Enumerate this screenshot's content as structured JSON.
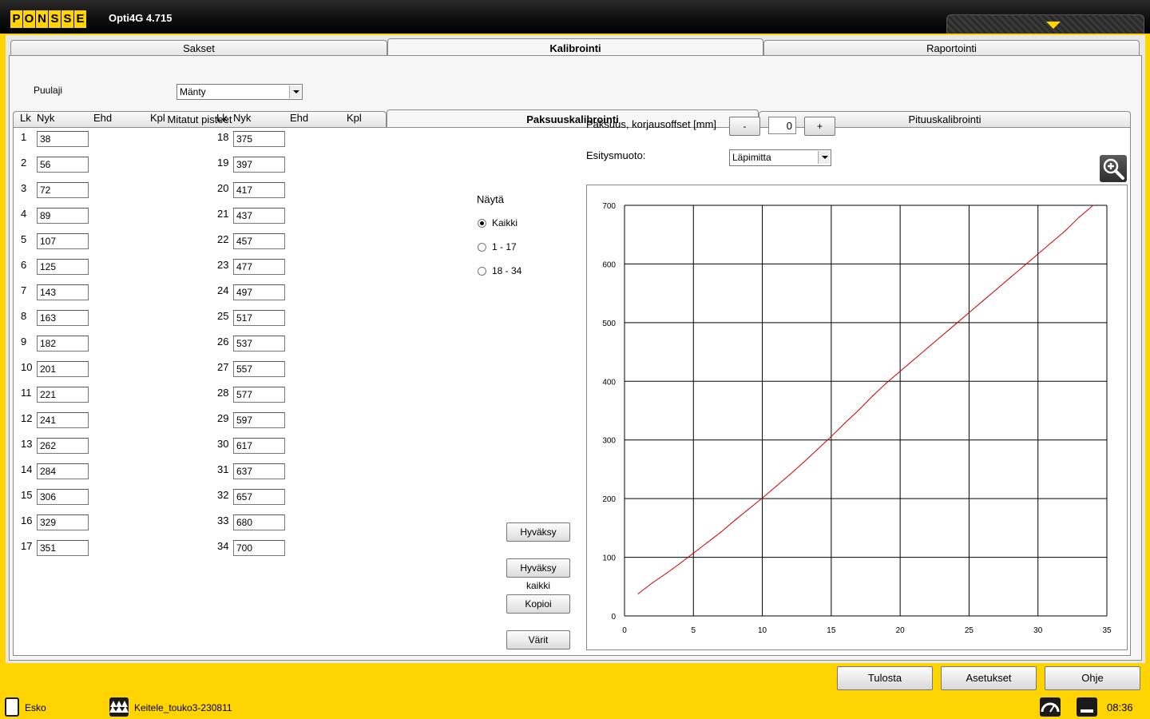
{
  "app": {
    "logo_letters": [
      "P",
      "O",
      "N",
      "S",
      "S",
      "E"
    ],
    "title": "Opti4G 4.715"
  },
  "top_tabs": [
    {
      "label": "Sakset",
      "active": false
    },
    {
      "label": "Kalibrointi",
      "active": true
    },
    {
      "label": "Raportointi",
      "active": false
    }
  ],
  "puulaji": {
    "label": "Puulaji",
    "value": "Mänty"
  },
  "sub_tabs": [
    {
      "label": "Mitatut pisteet",
      "active": false
    },
    {
      "label": "Paksuuskalibrointi",
      "active": true
    },
    {
      "label": "Pituuskalibrointi",
      "active": false
    }
  ],
  "table_headers": {
    "lk": "Lk",
    "nyk": "Nyk",
    "ehd": "Ehd",
    "kpl": "Kpl"
  },
  "rows_left": [
    {
      "lk": "1",
      "nyk": "38"
    },
    {
      "lk": "2",
      "nyk": "56"
    },
    {
      "lk": "3",
      "nyk": "72"
    },
    {
      "lk": "4",
      "nyk": "89"
    },
    {
      "lk": "5",
      "nyk": "107"
    },
    {
      "lk": "6",
      "nyk": "125"
    },
    {
      "lk": "7",
      "nyk": "143"
    },
    {
      "lk": "8",
      "nyk": "163"
    },
    {
      "lk": "9",
      "nyk": "182"
    },
    {
      "lk": "10",
      "nyk": "201"
    },
    {
      "lk": "11",
      "nyk": "221"
    },
    {
      "lk": "12",
      "nyk": "241"
    },
    {
      "lk": "13",
      "nyk": "262"
    },
    {
      "lk": "14",
      "nyk": "284"
    },
    {
      "lk": "15",
      "nyk": "306"
    },
    {
      "lk": "16",
      "nyk": "329"
    },
    {
      "lk": "17",
      "nyk": "351"
    }
  ],
  "rows_right": [
    {
      "lk": "18",
      "nyk": "375"
    },
    {
      "lk": "19",
      "nyk": "397"
    },
    {
      "lk": "20",
      "nyk": "417"
    },
    {
      "lk": "21",
      "nyk": "437"
    },
    {
      "lk": "22",
      "nyk": "457"
    },
    {
      "lk": "23",
      "nyk": "477"
    },
    {
      "lk": "24",
      "nyk": "497"
    },
    {
      "lk": "25",
      "nyk": "517"
    },
    {
      "lk": "26",
      "nyk": "537"
    },
    {
      "lk": "27",
      "nyk": "557"
    },
    {
      "lk": "28",
      "nyk": "577"
    },
    {
      "lk": "29",
      "nyk": "597"
    },
    {
      "lk": "30",
      "nyk": "617"
    },
    {
      "lk": "31",
      "nyk": "637"
    },
    {
      "lk": "32",
      "nyk": "657"
    },
    {
      "lk": "33",
      "nyk": "680"
    },
    {
      "lk": "34",
      "nyk": "700"
    }
  ],
  "nayta": {
    "label": "Näytä",
    "options": [
      {
        "label": "Kaikki",
        "selected": true
      },
      {
        "label": "1 - 17",
        "selected": false
      },
      {
        "label": "18 - 34",
        "selected": false
      }
    ]
  },
  "action_buttons": [
    "Hyväksy",
    "Hyväksy kaikki",
    "Kopioi",
    "Värit"
  ],
  "offset": {
    "label": "Paksuus, korjausoffset [mm]",
    "minus": "-",
    "value": "0",
    "plus": "+"
  },
  "esitysmuoto": {
    "label": "Esitysmuoto:",
    "value": "Läpimitta"
  },
  "chart_data": {
    "type": "line",
    "x": [
      1,
      2,
      3,
      4,
      5,
      6,
      7,
      8,
      9,
      10,
      11,
      12,
      13,
      14,
      15,
      16,
      17,
      18,
      19,
      20,
      21,
      22,
      23,
      24,
      25,
      26,
      27,
      28,
      29,
      30,
      31,
      32,
      33,
      34
    ],
    "series": [
      {
        "values": [
          38,
          56,
          72,
          89,
          107,
          125,
          143,
          163,
          182,
          201,
          221,
          241,
          262,
          284,
          306,
          329,
          351,
          375,
          397,
          417,
          437,
          457,
          477,
          497,
          517,
          537,
          557,
          577,
          597,
          617,
          637,
          657,
          680,
          700
        ],
        "color": "#cc0000"
      }
    ],
    "xlim": [
      0,
      35
    ],
    "ylim": [
      0,
      700
    ],
    "xticks": [
      "0",
      "5",
      "10",
      "15",
      "20",
      "25",
      "30",
      "35"
    ],
    "yticks": [
      "0",
      "100",
      "200",
      "300",
      "400",
      "500",
      "600",
      "700"
    ],
    "grid": true
  },
  "bottom_buttons": [
    "Tulosta",
    "Asetukset",
    "Ohje"
  ],
  "status": {
    "user": "Esko",
    "site": "Keitele_touko3-230811",
    "time": "08:36"
  },
  "colors": {
    "brand": "#FFD400",
    "line": "#cc0000"
  }
}
